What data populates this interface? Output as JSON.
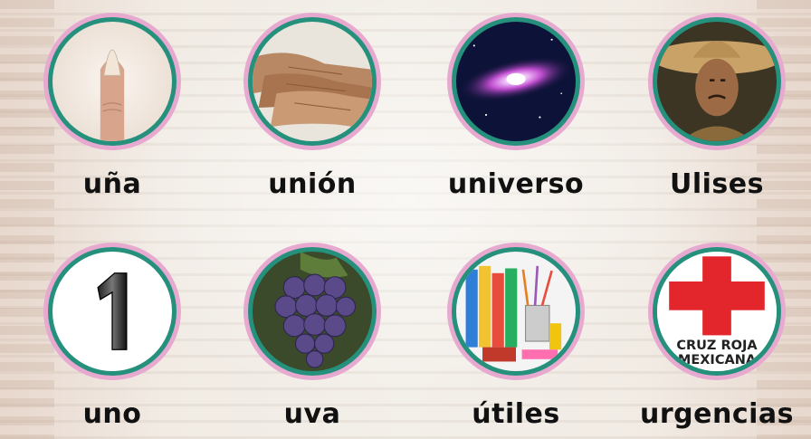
{
  "cards": [
    {
      "word": "uña",
      "icon": "fingernail-icon"
    },
    {
      "word": "unión",
      "icon": "joined-hands-icon"
    },
    {
      "word": "universo",
      "icon": "galaxy-icon"
    },
    {
      "word": "Ulises",
      "icon": "man-with-hat-icon"
    },
    {
      "word": "uno",
      "icon": "number-one-icon"
    },
    {
      "word": "uva",
      "icon": "grapes-icon"
    },
    {
      "word": "útiles",
      "icon": "school-supplies-icon"
    },
    {
      "word": "urgencias",
      "icon": "red-cross-icon"
    }
  ],
  "red_cross_text": {
    "line1": "CRUZ ROJA",
    "line2": "MEXICANA"
  },
  "colors": {
    "ring_pink": "#e7a9d0",
    "ring_teal": "#25907c",
    "text": "#111111",
    "cross_red": "#e3262b"
  }
}
